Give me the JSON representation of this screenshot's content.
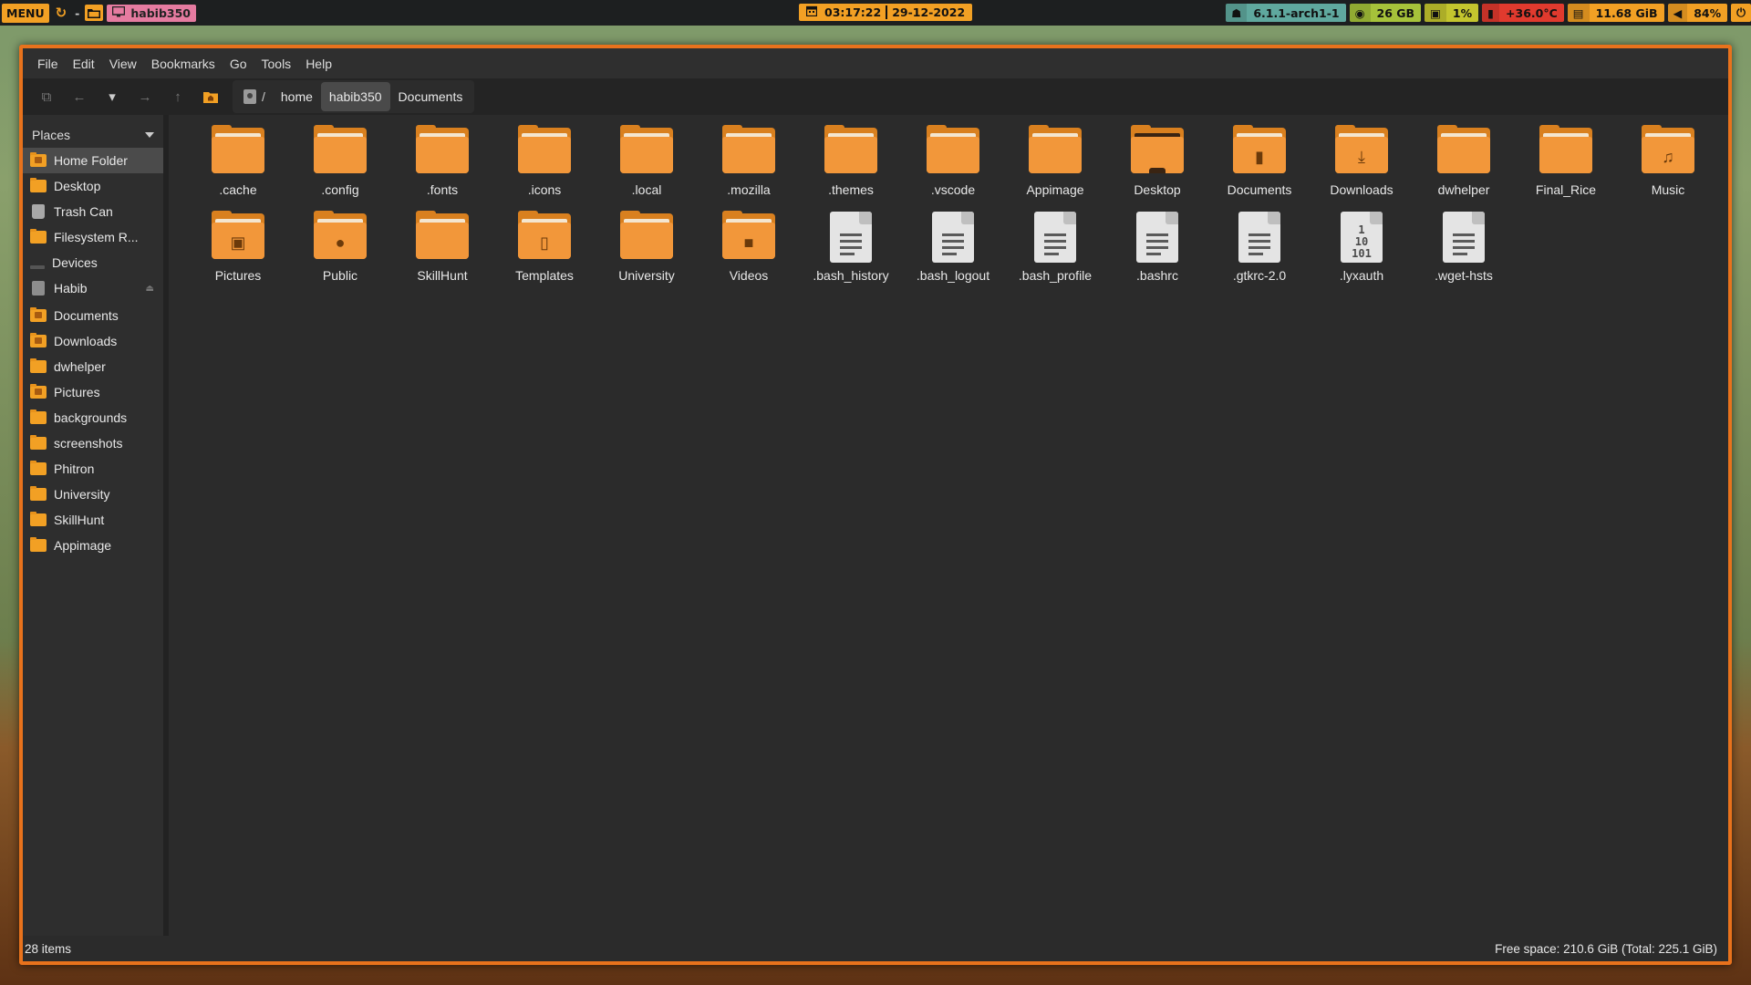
{
  "topbar": {
    "menu_label": "MENU",
    "workspace_glyph": "↻",
    "separator": "-",
    "terminal_label": "habib350",
    "clock": {
      "time": "03:17:22",
      "date": "29-12-2022"
    },
    "modules": [
      {
        "name": "kernel",
        "icon": "tux-icon",
        "value": "6.1.1-arch1-1",
        "color": "#5fa89e"
      },
      {
        "name": "disk",
        "icon": "disk-icon",
        "value": "26 GB",
        "color": "#a6c23a"
      },
      {
        "name": "cpu",
        "icon": "cpu-icon",
        "value": "1%",
        "color": "#c4c52e"
      },
      {
        "name": "temperature",
        "icon": "thermometer-icon",
        "value": "+36.0°C",
        "color": "#e03a2e"
      },
      {
        "name": "memory",
        "icon": "memory-icon",
        "value": "11.68 GiB",
        "color": "#f2a024"
      },
      {
        "name": "volume",
        "icon": "speaker-icon",
        "value": "84%",
        "color": "#f2a024"
      }
    ]
  },
  "menubar": [
    "File",
    "Edit",
    "View",
    "Bookmarks",
    "Go",
    "Tools",
    "Help"
  ],
  "breadcrumb": {
    "root": "/",
    "parts": [
      "home",
      "habib350",
      "Documents"
    ],
    "selected": "habib350"
  },
  "sidebar": {
    "header": "Places",
    "places": [
      {
        "label": "Home Folder",
        "icon": "home-folder-icon",
        "selected": true
      },
      {
        "label": "Desktop",
        "icon": "folder-icon"
      },
      {
        "label": "Trash Can",
        "icon": "trash-icon"
      },
      {
        "label": "Filesystem R...",
        "icon": "folder-icon"
      },
      {
        "label": "Devices",
        "icon": "device-icon"
      },
      {
        "label": "Habib",
        "icon": "drive-icon",
        "ejectable": true
      }
    ],
    "bookmarks": [
      {
        "label": "Documents",
        "icon": "documents-folder-icon"
      },
      {
        "label": "Downloads",
        "icon": "downloads-folder-icon"
      },
      {
        "label": "dwhelper",
        "icon": "folder-icon"
      },
      {
        "label": "Pictures",
        "icon": "pictures-folder-icon"
      },
      {
        "label": "backgrounds",
        "icon": "folder-icon"
      },
      {
        "label": "screenshots",
        "icon": "folder-icon"
      },
      {
        "label": "Phitron",
        "icon": "folder-icon"
      },
      {
        "label": "University",
        "icon": "folder-icon"
      },
      {
        "label": "SkillHunt",
        "icon": "folder-icon"
      },
      {
        "label": "Appimage",
        "icon": "folder-icon"
      }
    ]
  },
  "files": [
    {
      "name": ".cache",
      "kind": "folder",
      "emblem": ""
    },
    {
      "name": ".config",
      "kind": "folder",
      "emblem": ""
    },
    {
      "name": ".fonts",
      "kind": "folder",
      "emblem": ""
    },
    {
      "name": ".icons",
      "kind": "folder",
      "emblem": ""
    },
    {
      "name": ".local",
      "kind": "folder",
      "emblem": ""
    },
    {
      "name": ".mozilla",
      "kind": "folder",
      "emblem": ""
    },
    {
      "name": ".themes",
      "kind": "folder",
      "emblem": ""
    },
    {
      "name": ".vscode",
      "kind": "folder",
      "emblem": ""
    },
    {
      "name": "Appimage",
      "kind": "folder",
      "emblem": ""
    },
    {
      "name": "Desktop",
      "kind": "folder",
      "emblem": "desktop"
    },
    {
      "name": "Documents",
      "kind": "folder",
      "emblem": "document"
    },
    {
      "name": "Downloads",
      "kind": "folder",
      "emblem": "download"
    },
    {
      "name": "dwhelper",
      "kind": "folder",
      "emblem": ""
    },
    {
      "name": "Final_Rice",
      "kind": "folder",
      "emblem": ""
    },
    {
      "name": "Music",
      "kind": "folder",
      "emblem": "music"
    },
    {
      "name": "Pictures",
      "kind": "folder",
      "emblem": "picture"
    },
    {
      "name": "Public",
      "kind": "folder",
      "emblem": "person"
    },
    {
      "name": "SkillHunt",
      "kind": "folder",
      "emblem": ""
    },
    {
      "name": "Templates",
      "kind": "folder",
      "emblem": "template"
    },
    {
      "name": "University",
      "kind": "folder",
      "emblem": ""
    },
    {
      "name": "Videos",
      "kind": "folder",
      "emblem": "video"
    },
    {
      "name": ".bash_history",
      "kind": "text"
    },
    {
      "name": ".bash_logout",
      "kind": "text"
    },
    {
      "name": ".bash_profile",
      "kind": "text"
    },
    {
      "name": ".bashrc",
      "kind": "text"
    },
    {
      "name": ".gtkrc-2.0",
      "kind": "text"
    },
    {
      "name": ".lyxauth",
      "kind": "binary"
    },
    {
      "name": ".wget-hsts",
      "kind": "text"
    }
  ],
  "status": {
    "items": "28 items",
    "free_space": "Free space: 210.6 GiB (Total: 225.1 GiB)"
  },
  "colors": {
    "accent": "#f2a024",
    "window_border": "#e8721c",
    "folder": "#f2973a"
  }
}
